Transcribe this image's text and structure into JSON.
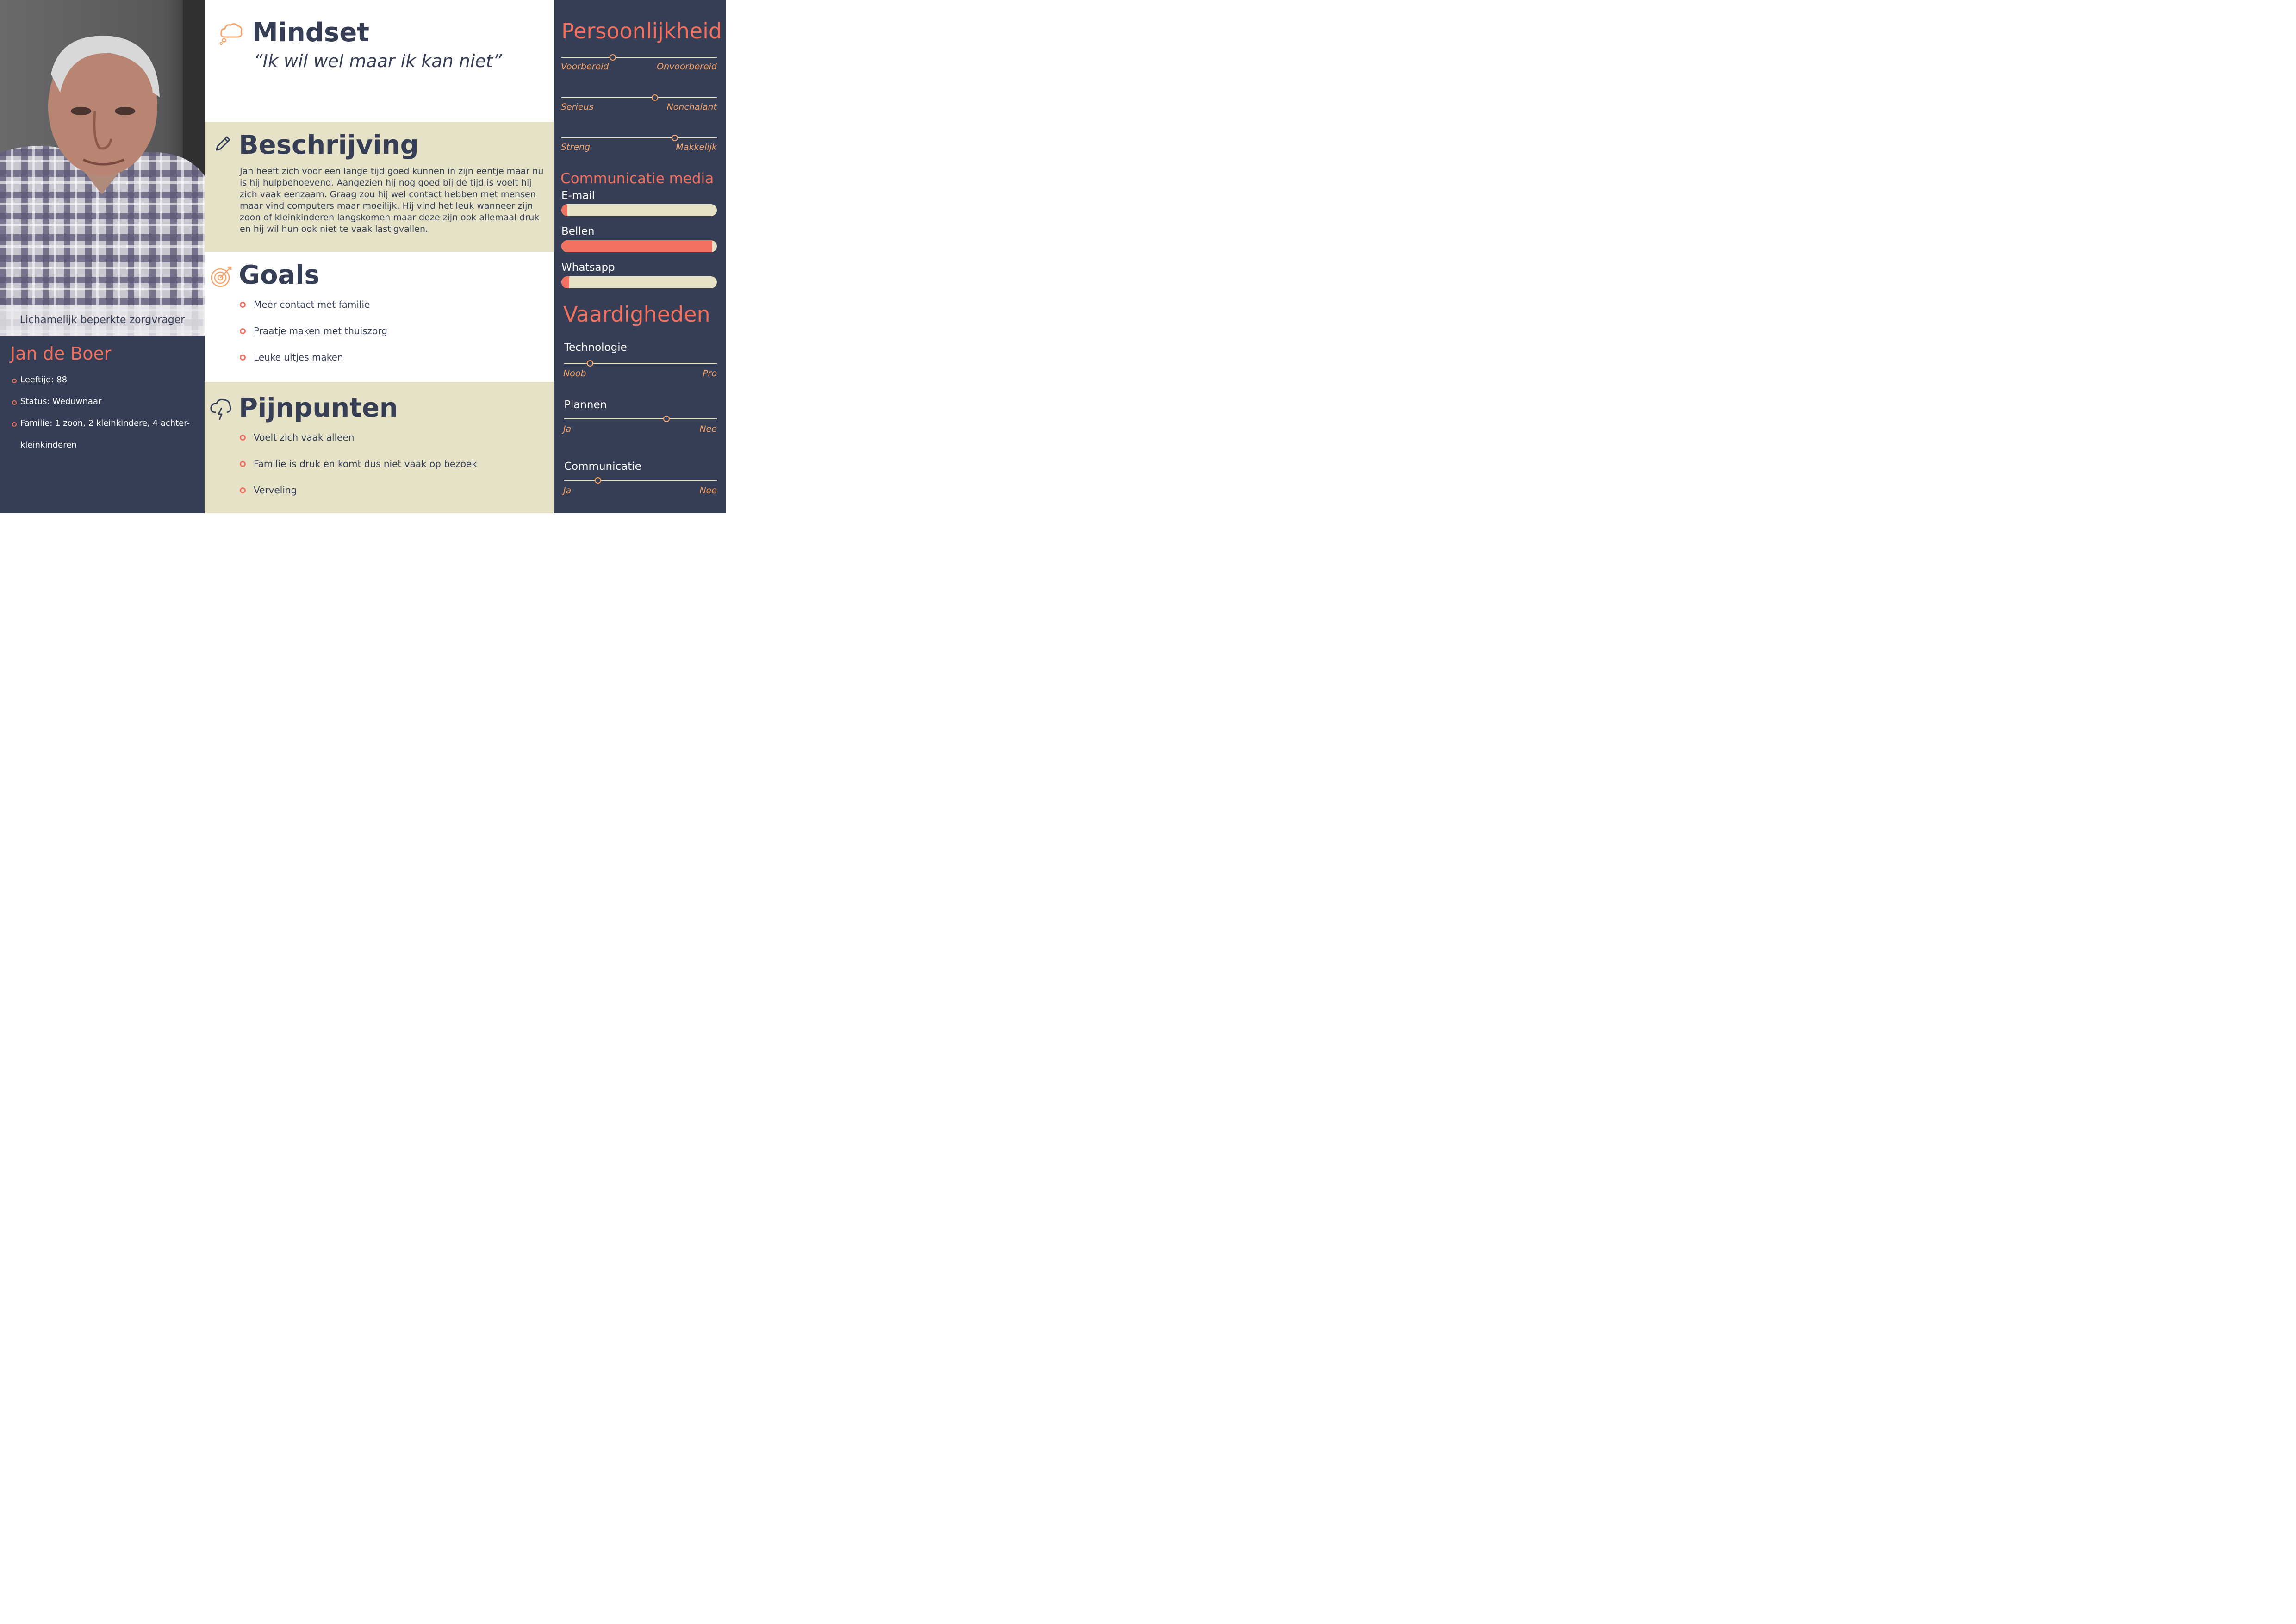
{
  "profile": {
    "caption": "Lichamelijk beperkte zorgvrager",
    "name": "Jan de Boer",
    "details": [
      "Leeftijd: 88",
      "Status: Weduwnaar",
      "Familie: 1 zoon, 2 kleinkindere, 4 achter-",
      "kleinkinderen"
    ]
  },
  "mindset": {
    "title": "Mindset",
    "quote": "“Ik wil wel maar ik kan niet”"
  },
  "beschrijving": {
    "title": "Beschrijving",
    "text": "Jan heeft zich voor een lange tijd goed kunnen in zijn eentje maar nu is hij hulpbehoevend. Aangezien hij nog goed bij de tijd is voelt hij zich vaak eenzaam. Graag zou hij wel contact hebben met mensen maar vind computers maar moeilijk.  Hij vind het leuk wanneer zijn zoon of kleinkinderen langskomen maar deze zijn ook allemaal druk en hij wil hun ook niet te vaak lastigvallen."
  },
  "goals": {
    "title": "Goals",
    "items": [
      "Meer contact met familie",
      "Praatje maken met thuiszorg",
      "Leuke uitjes maken"
    ]
  },
  "pijnpunten": {
    "title": "Pijnpunten",
    "items": [
      "Voelt zich vaak alleen",
      "Familie is druk en komt dus niet vaak op bezoek",
      "Verveling"
    ]
  },
  "persoonlijkheid": {
    "title": "Persoonlijkheid",
    "sliders": [
      {
        "left": "Voorbereid",
        "right": "Onvoorbereid",
        "value": 0.33
      },
      {
        "left": "Serieus",
        "right": "Nonchalant",
        "value": 0.6
      },
      {
        "left": "Streng",
        "right": "Makkelijk",
        "value": 0.73
      }
    ]
  },
  "communicatie_media": {
    "title": "Communicatie media",
    "items": [
      {
        "label": "E-mail",
        "value": 0.04
      },
      {
        "label": "Bellen",
        "value": 0.97
      },
      {
        "label": "Whatsapp",
        "value": 0.05
      }
    ]
  },
  "vaardigheden": {
    "title": "Vaardigheden",
    "items": [
      {
        "label": "Technologie",
        "left": "Noob",
        "right": "Pro",
        "value": 0.17
      },
      {
        "label": "Plannen",
        "left": "Ja",
        "right": "Nee",
        "value": 0.67
      },
      {
        "label": "Communicatie",
        "left": "Ja",
        "right": "Nee",
        "value": 0.22
      }
    ]
  },
  "colors": {
    "navy": "#353e55",
    "beige": "#e6e2c7",
    "salmon": "#f0715f",
    "orange": "#f6a46b"
  }
}
